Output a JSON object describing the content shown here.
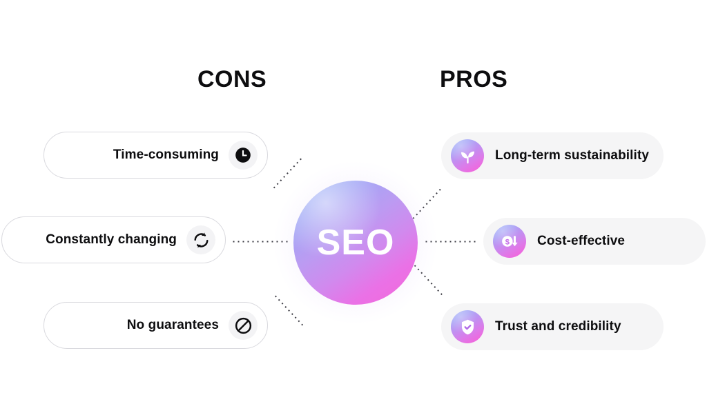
{
  "headings": {
    "cons": "CONS",
    "pros": "PROS"
  },
  "center": {
    "label": "SEO",
    "gradient_from": "#8fb4f7",
    "gradient_to": "#f368d8"
  },
  "cons_items": [
    {
      "label": "Time-consuming",
      "icon": "clock-icon"
    },
    {
      "label": "Constantly changing",
      "icon": "refresh-icon"
    },
    {
      "label": "No guarantees",
      "icon": "ban-icon"
    }
  ],
  "pros_items": [
    {
      "label": "Long-term sustainability",
      "icon": "sprout-icon"
    },
    {
      "label": "Cost-effective",
      "icon": "dollar-down-icon"
    },
    {
      "label": "Trust and credibility",
      "icon": "shield-check-icon"
    }
  ],
  "colors": {
    "text": "#0d0d0f",
    "cons_pill_bg": "#ffffff",
    "cons_pill_border": "#d9d9de",
    "cons_badge_bg": "#f3f3f5",
    "pros_pill_bg": "#f5f5f6",
    "connector_dot": "#3a3a42"
  }
}
